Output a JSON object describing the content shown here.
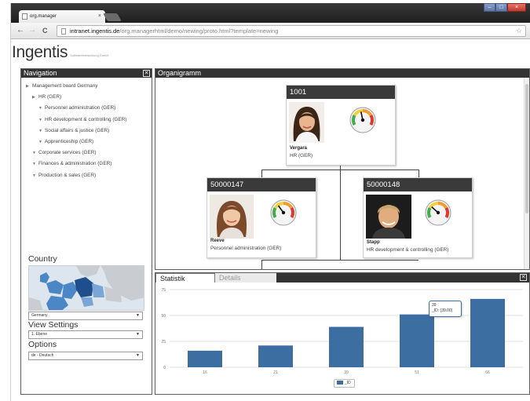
{
  "browser": {
    "tab_title": "org.manager",
    "tab_close": "×",
    "url_host": "intranet.ingentis.de",
    "url_path": "/org.managerhtml/demo/newing/proto.html?template=newing",
    "back": "←",
    "forward": "→",
    "reload": "C",
    "star": "☆"
  },
  "app": {
    "brand": "Ingentis",
    "brand_sub": "Softwareentwicklung GmbH"
  },
  "navigation": {
    "title": "Navigation",
    "tree": [
      {
        "label": "Management board Germany",
        "level": 0,
        "arrow": "▶"
      },
      {
        "label": "HR (GER)",
        "level": 1,
        "arrow": "▶"
      },
      {
        "label": "Personnel administration (GER)",
        "level": 2,
        "arrow": "▼"
      },
      {
        "label": "HR development & controlling (GER)",
        "level": 2,
        "arrow": "▼"
      },
      {
        "label": "Social affairs & justice (GER)",
        "level": 2,
        "arrow": "▼"
      },
      {
        "label": "Apprenticeship (GER)",
        "level": 2,
        "arrow": "▼"
      },
      {
        "label": "Corporate services (GER)",
        "level": 1,
        "arrow": "▼"
      },
      {
        "label": "Finances & administration (GER)",
        "level": 1,
        "arrow": "▼"
      },
      {
        "label": "Production & sales (GER)",
        "level": 1,
        "arrow": "▼"
      }
    ],
    "country_label": "Country",
    "country_value": "Germany",
    "view_settings_label": "View Settings",
    "view_settings_value": "1. Ebene",
    "options_label": "Options",
    "options_value": "de - Deutsch",
    "caret": "▼"
  },
  "orgchart": {
    "title": "Organigramm",
    "cards": [
      {
        "id": "1001",
        "name": "Vergara",
        "dept": "HR (GER)",
        "gauge_level": 0.45
      },
      {
        "id": "50000147",
        "name": "Reeve",
        "dept": "Personnel administration (GER)",
        "gauge_level": 0.35
      },
      {
        "id": "50000148",
        "name": "Stapp",
        "dept": "HR development & controlling (GER)",
        "gauge_level": 0.3
      }
    ]
  },
  "stats": {
    "tab_active": "Statistik",
    "tab_inactive": "Details",
    "tooltip_title": "39",
    "tooltip_value": "_ID: (39.00)",
    "legend_label": "_ID"
  },
  "chart_data": {
    "type": "bar",
    "categories": [
      "16",
      "21",
      "39",
      "51",
      "66"
    ],
    "values": [
      16,
      21,
      39,
      51,
      66
    ],
    "yticks": [
      0,
      25,
      50,
      75
    ],
    "ylim": [
      0,
      75
    ],
    "grid": true,
    "legend_position": "bottom-center",
    "series": [
      {
        "name": "_ID",
        "values": [
          16,
          21,
          39,
          51,
          66
        ]
      }
    ],
    "bar_color": "#3d6ea2"
  },
  "colors": {
    "panel_header": "#333333",
    "bar": "#3d6ea2",
    "map_highlight": "#4b86c6",
    "map_selected": "#1e4f8c"
  }
}
